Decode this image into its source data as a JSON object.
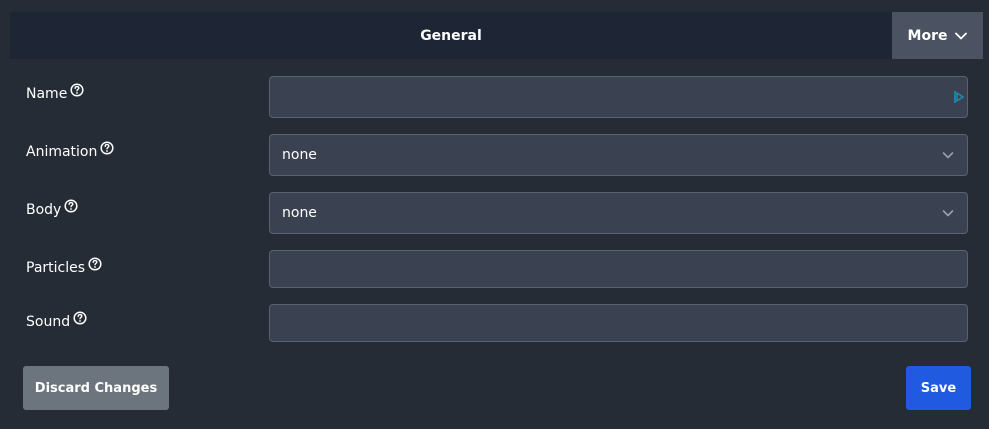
{
  "tabs": {
    "general_label": "General",
    "more_label": "More"
  },
  "form": {
    "name": {
      "label": "Name",
      "value": ""
    },
    "animation": {
      "label": "Animation",
      "value": "none"
    },
    "body": {
      "label": "Body",
      "value": "none"
    },
    "particles": {
      "label": "Particles",
      "value": ""
    },
    "sound": {
      "label": "Sound",
      "value": ""
    }
  },
  "actions": {
    "discard_label": "Discard Changes",
    "save_label": "Save"
  },
  "colors": {
    "background": "#262c36",
    "tabbar": "#1e2534",
    "more_tab": "#4b5362",
    "field": "#3a4150",
    "discard": "#6c757d",
    "save": "#1f5ae0",
    "accent_icon": "#1a8fb8"
  },
  "icons": {
    "help": "question-circle-icon",
    "chevron": "chevron-down-icon",
    "field_end": "play-icon"
  }
}
